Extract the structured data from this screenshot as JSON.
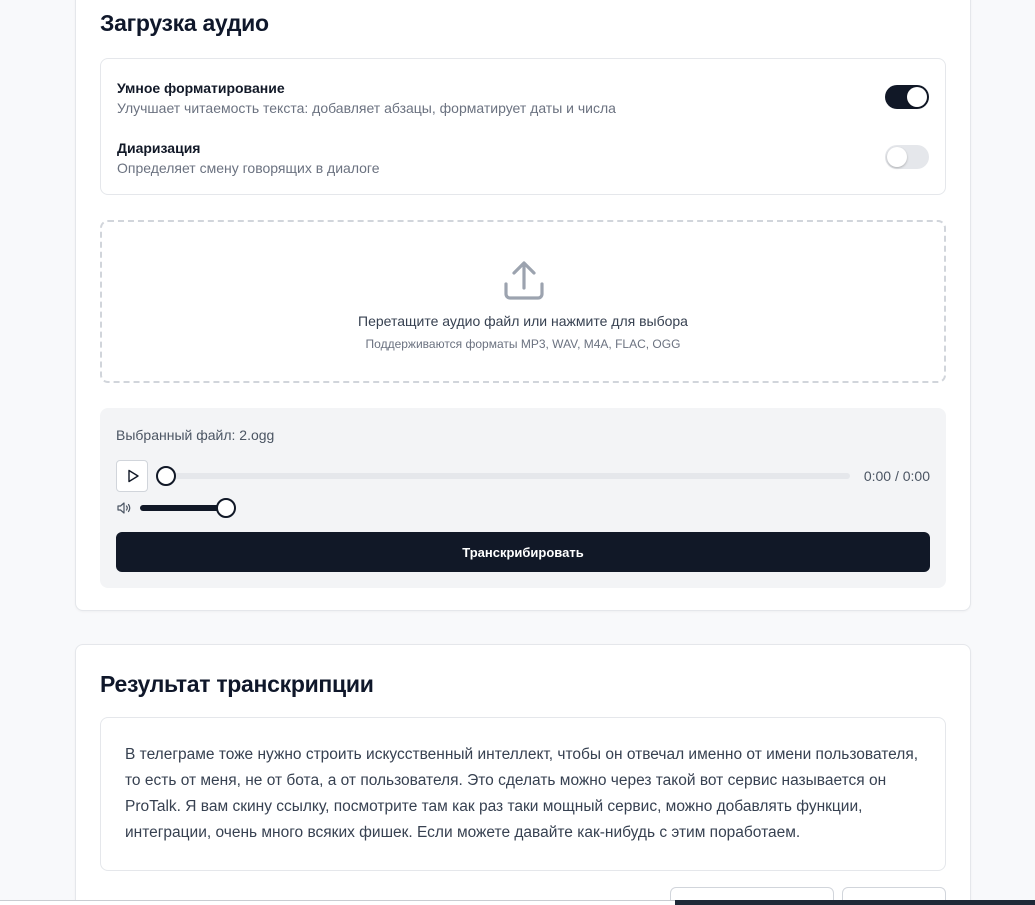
{
  "upload": {
    "title": "Загрузка аудио",
    "options": [
      {
        "title": "Умное форматирование",
        "description": "Улучшает читаемость текста: добавляет абзацы, форматирует даты и числа",
        "enabled": true
      },
      {
        "title": "Диаризация",
        "description": "Определяет смену говорящих в диалоге",
        "enabled": false
      }
    ],
    "dropzone": {
      "icon": "upload-icon",
      "main_text": "Перетащите аудио файл или нажмите для выбора",
      "sub_text": "Поддерживаются форматы MP3, WAV, M4A, FLAC, OGG"
    },
    "file": {
      "label": "Выбранный файл: 2.ogg",
      "time": "0:00 / 0:00",
      "progress": 0,
      "volume": 1,
      "play_icon": "play-icon",
      "volume_icon": "volume-icon"
    },
    "transcribe_label": "Транскрибировать"
  },
  "result": {
    "title": "Результат транскрипции",
    "text": "В телеграме тоже нужно строить искусственный интеллект, чтобы он отвечал именно от имени пользователя, то есть от меня, не от бота, а от пользователя. Это сделать можно через такой вот сервис называется он ProTalk. Я вам скину ссылку, посмотрите там как раз таки мощный сервис, можно добавлять функции, интеграции, очень много всяких фишек. Если можете давайте как-нибудь с этим поработаем."
  },
  "colors": {
    "accent": "#111827",
    "background": "#f8f9fb"
  }
}
